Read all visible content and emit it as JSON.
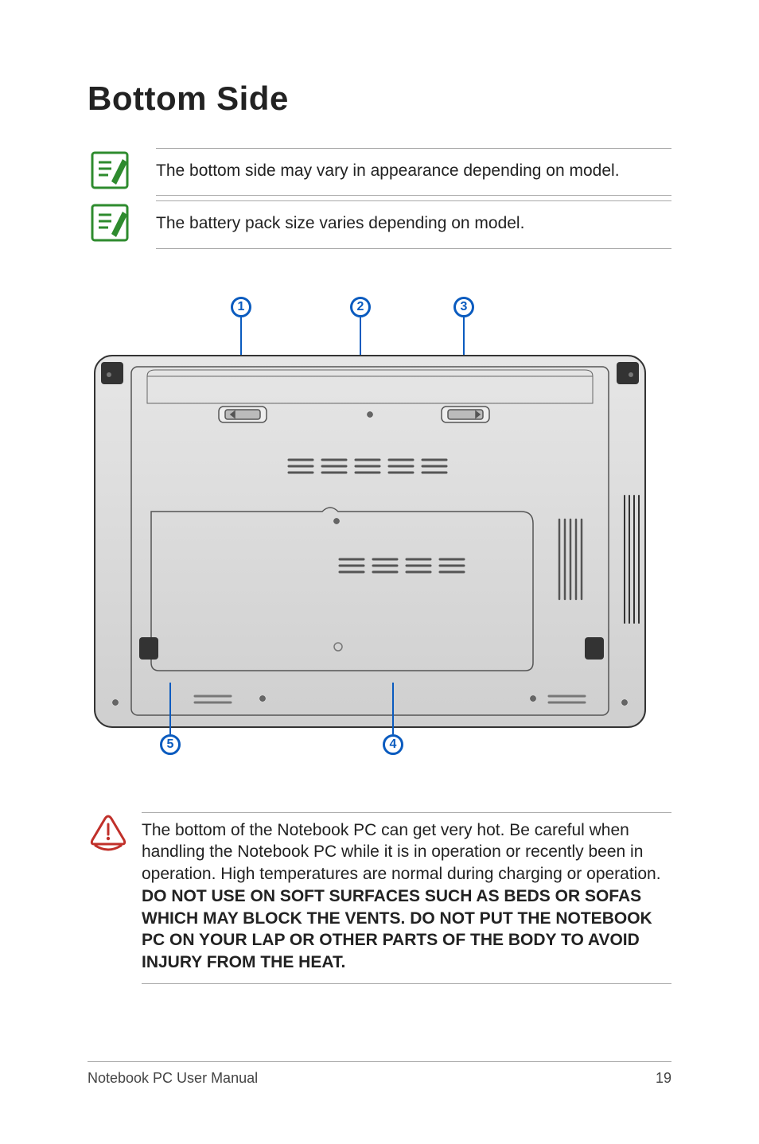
{
  "title": "Bottom Side",
  "notes": [
    "The bottom side may vary in appearance depending on model.",
    "The battery pack size varies depending on model."
  ],
  "callouts": {
    "top": [
      "1",
      "2",
      "3"
    ],
    "bottom_left": "5",
    "bottom_right": "4"
  },
  "warning": {
    "lead": "The bottom of the Notebook PC can get very hot. Be careful when handling the Notebook PC while it is in operation or recently been in operation. High temperatures are normal during charging or operation. ",
    "bold": "DO NOT USE ON SOFT SURFACES SUCH AS BEDS OR SOFAS WHICH MAY BLOCK THE VENTS. DO NOT PUT THE NOTEBOOK PC ON YOUR LAP OR OTHER PARTS OF THE BODY TO AVOID INJURY FROM THE HEAT."
  },
  "footer": {
    "left": "Notebook PC User Manual",
    "right": "19"
  }
}
